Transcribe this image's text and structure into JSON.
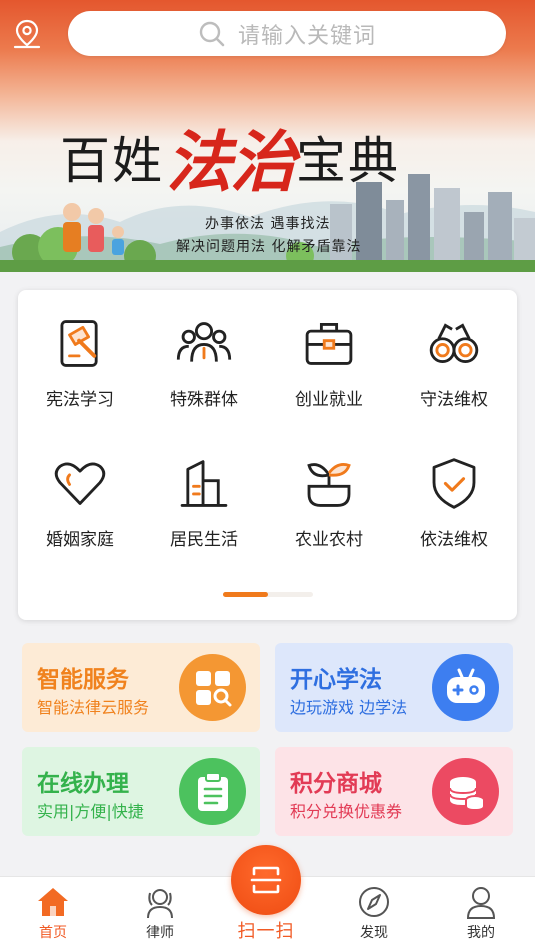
{
  "search": {
    "placeholder": "请输入关键词"
  },
  "banner": {
    "title_part1": "百姓",
    "title_accent": "法治",
    "title_part2": "宝典",
    "slogan_line1": "办事依法  遇事找法",
    "slogan_line2": "解决问题用法  化解矛盾靠法"
  },
  "categories": [
    {
      "label": "宪法学习",
      "icon": "constitution-book-icon"
    },
    {
      "label": "特殊群体",
      "icon": "group-people-icon"
    },
    {
      "label": "创业就业",
      "icon": "briefcase-icon"
    },
    {
      "label": "守法维权",
      "icon": "handcuffs-icon"
    },
    {
      "label": "婚姻家庭",
      "icon": "heart-icon"
    },
    {
      "label": "居民生活",
      "icon": "building-icon"
    },
    {
      "label": "农业农村",
      "icon": "sprout-icon"
    },
    {
      "label": "依法维权",
      "icon": "shield-check-icon"
    }
  ],
  "services": [
    {
      "title": "智能服务",
      "subtitle": "智能法律云服务",
      "icon": "grid-search-icon",
      "title_color": "#f0821e",
      "bg": "#fdebd6",
      "badge_color": "#f49733"
    },
    {
      "title": "开心学法",
      "subtitle": "边玩游戏 边学法",
      "icon": "gamepad-icon",
      "title_color": "#2f6fe0",
      "bg": "#dde7fb",
      "badge_color": "#3d7ef0"
    },
    {
      "title": "在线办理",
      "subtitle": "实用|方便|快捷",
      "icon": "clipboard-icon",
      "title_color": "#34b24c",
      "bg": "#def5e2",
      "badge_color": "#4cc25e"
    },
    {
      "title": "积分商城",
      "subtitle": "积分兑换优惠券",
      "icon": "coins-icon",
      "title_color": "#e23b55",
      "bg": "#fde3e7",
      "badge_color": "#ec4a62"
    }
  ],
  "tabbar": {
    "home": "首页",
    "lawyer": "律师",
    "scan": "扫一扫",
    "discover": "发现",
    "mine": "我的"
  }
}
